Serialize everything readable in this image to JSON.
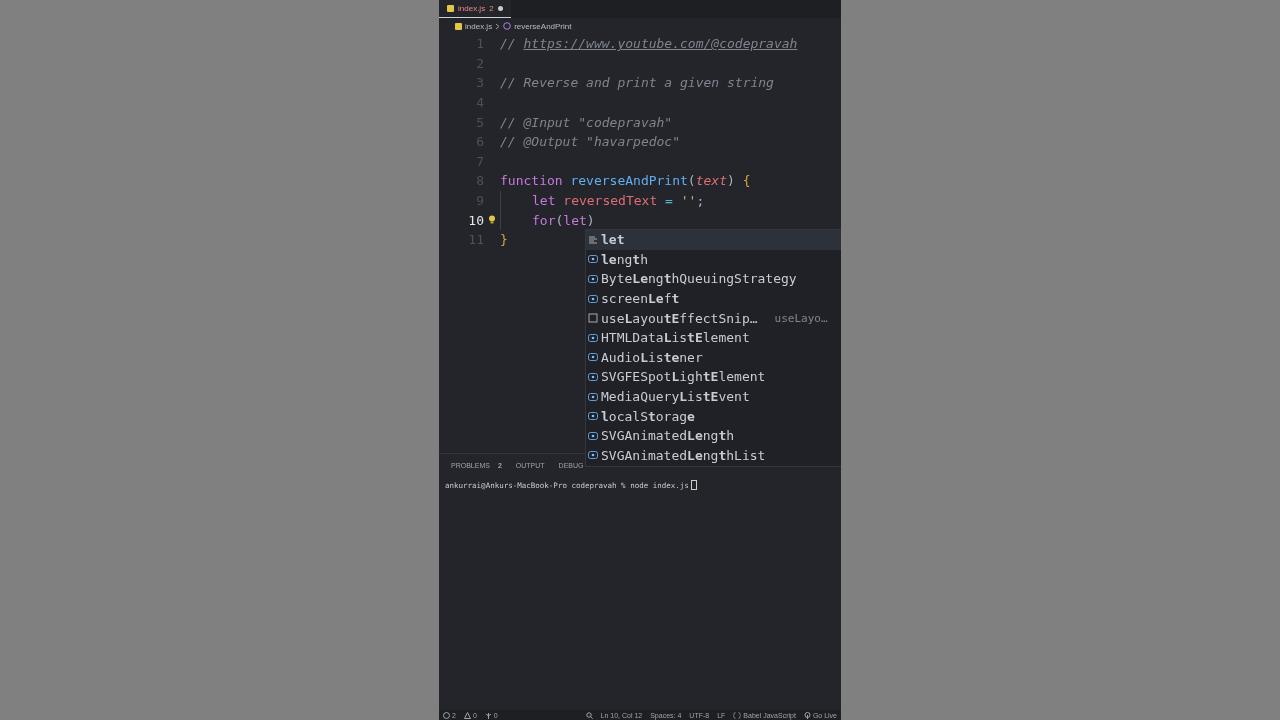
{
  "tabs": [
    {
      "label": "index.js",
      "badge": "2",
      "modified": true,
      "selected": true
    }
  ],
  "breadcrumbs": [
    "index.js",
    "reverseAndPrint"
  ],
  "editor": {
    "lines": [
      {
        "number": "1",
        "active": false,
        "indented": false,
        "tokens": [
          {
            "text": "// ",
            "kind": "comment"
          },
          {
            "text": "https://www.youtube.com/@codepravah",
            "kind": "link"
          }
        ]
      },
      {
        "number": "2",
        "active": false,
        "indented": false
      },
      {
        "number": "3",
        "active": false,
        "indented": false,
        "tokens": [
          {
            "text": "// Reverse and print a given string",
            "kind": "comment"
          }
        ]
      },
      {
        "number": "4",
        "active": false,
        "indented": false
      },
      {
        "number": "5",
        "active": false,
        "indented": false,
        "tokens": [
          {
            "text": "// @Input \"codepravah\"",
            "kind": "comment"
          }
        ]
      },
      {
        "number": "6",
        "active": false,
        "indented": false,
        "tokens": [
          {
            "text": "// @Output \"havarpedoc\"",
            "kind": "comment"
          }
        ]
      },
      {
        "number": "7",
        "active": false,
        "indented": false
      },
      {
        "number": "8",
        "active": false,
        "indented": false,
        "tokens": [
          {
            "text": "function ",
            "kind": "keyword"
          },
          {
            "text": "reverseAndPrint",
            "kind": "function"
          },
          {
            "text": "(",
            "kind": "punct"
          },
          {
            "text": "text",
            "kind": "param"
          },
          {
            "text": ") ",
            "kind": "punct"
          },
          {
            "text": "{",
            "kind": "brace"
          }
        ]
      },
      {
        "number": "9",
        "active": false,
        "indented": true,
        "tokens": [
          {
            "text": "let ",
            "kind": "keyword"
          },
          {
            "text": "reversedText ",
            "kind": "variable"
          },
          {
            "text": "= ",
            "kind": "operator"
          },
          {
            "text": "''",
            "kind": "string"
          },
          {
            "text": ";",
            "kind": "punct"
          }
        ]
      },
      {
        "number": "10",
        "active": true,
        "indented": true,
        "tokens": [
          {
            "text": "for",
            "kind": "keyword"
          },
          {
            "text": "(",
            "kind": "punct"
          },
          {
            "text": "let",
            "kind": "keyword"
          },
          {
            "text": ")",
            "kind": "punct"
          }
        ]
      },
      {
        "number": "11",
        "active": false,
        "indented": false,
        "tokens": [
          {
            "text": "}",
            "kind": "brace"
          }
        ]
      }
    ]
  },
  "suggestions": [
    {
      "label": "**let**",
      "kind": "keyword",
      "selected": true
    },
    {
      "label": "**le**ng**t**h",
      "kind": "variable",
      "selected": false
    },
    {
      "label": "Byte**Le**ng**t**hQueuingStrategy",
      "kind": "variable",
      "selected": false
    },
    {
      "label": "screen**Le**f**t**",
      "kind": "variable",
      "selected": false
    },
    {
      "label": "use**L**ayou**tE**ffectSnip…",
      "kind": "snippet",
      "detail": "useLayo…",
      "selected": false
    },
    {
      "label": "HTMLData**L**is**tE**lement",
      "kind": "variable",
      "selected": false
    },
    {
      "label": "Audio**L**is**te**ner",
      "kind": "variable",
      "selected": false
    },
    {
      "label": "SVGFESpot**L**igh**tE**lement",
      "kind": "variable",
      "selected": false
    },
    {
      "label": "MediaQuery**L**is**tE**vent",
      "kind": "variable",
      "selected": false
    },
    {
      "label": "**l**ocalS**t**orag**e**",
      "kind": "variable",
      "selected": false
    },
    {
      "label": "SVGAnimated**Le**ng**t**h",
      "kind": "variable",
      "selected": false
    },
    {
      "label": "SVGAnimated**Le**ng**t**hList",
      "kind": "variable",
      "selected": false
    }
  ],
  "panel": {
    "tabs": [
      {
        "label": "PROBLEMS",
        "badge": "2",
        "selected": false
      },
      {
        "label": "OUTPUT",
        "selected": false
      },
      {
        "label": "DEBUG",
        "selected": false
      }
    ],
    "terminal": "ankurrai@Ankurs-MacBook-Pro codepravah % node index.js"
  },
  "status_bar": {
    "errors": "2",
    "warnings": "0",
    "ports": "0",
    "position": "Ln 10, Col 12",
    "indent": "Spaces: 4",
    "encoding": "UTF-8",
    "eol": "LF",
    "language": "Babel JavaScript",
    "live": "Go Live"
  }
}
